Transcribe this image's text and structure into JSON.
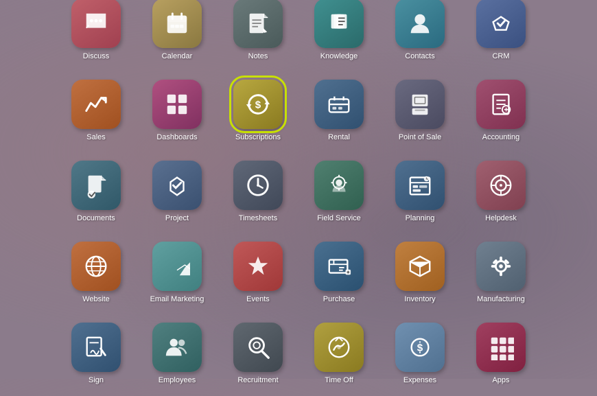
{
  "apps": [
    {
      "id": "discuss",
      "label": "Discuss",
      "bg": "bg-discuss",
      "icon": "discuss"
    },
    {
      "id": "calendar",
      "label": "Calendar",
      "bg": "bg-calendar",
      "icon": "calendar"
    },
    {
      "id": "notes",
      "label": "Notes",
      "bg": "bg-notes",
      "icon": "notes"
    },
    {
      "id": "knowledge",
      "label": "Knowledge",
      "bg": "bg-knowledge",
      "icon": "knowledge"
    },
    {
      "id": "contacts",
      "label": "Contacts",
      "bg": "bg-contacts",
      "icon": "contacts"
    },
    {
      "id": "crm",
      "label": "CRM",
      "bg": "bg-crm",
      "icon": "crm"
    },
    {
      "id": "sales",
      "label": "Sales",
      "bg": "bg-sales",
      "icon": "sales"
    },
    {
      "id": "dashboards",
      "label": "Dashboards",
      "bg": "bg-dashboards",
      "icon": "dashboards"
    },
    {
      "id": "subscriptions",
      "label": "Subscriptions",
      "bg": "bg-subscriptions",
      "icon": "subscriptions",
      "highlight": true
    },
    {
      "id": "rental",
      "label": "Rental",
      "bg": "bg-rental",
      "icon": "rental"
    },
    {
      "id": "pos",
      "label": "Point of Sale",
      "bg": "bg-pos",
      "icon": "pos"
    },
    {
      "id": "accounting",
      "label": "Accounting",
      "bg": "bg-accounting",
      "icon": "accounting"
    },
    {
      "id": "documents",
      "label": "Documents",
      "bg": "bg-documents",
      "icon": "documents"
    },
    {
      "id": "project",
      "label": "Project",
      "bg": "bg-project",
      "icon": "project"
    },
    {
      "id": "timesheets",
      "label": "Timesheets",
      "bg": "bg-timesheets",
      "icon": "timesheets"
    },
    {
      "id": "fieldservice",
      "label": "Field Service",
      "bg": "bg-fieldservice",
      "icon": "fieldservice"
    },
    {
      "id": "planning",
      "label": "Planning",
      "bg": "bg-planning",
      "icon": "planning"
    },
    {
      "id": "helpdesk",
      "label": "Helpdesk",
      "bg": "bg-helpdesk",
      "icon": "helpdesk"
    },
    {
      "id": "website",
      "label": "Website",
      "bg": "bg-website",
      "icon": "website"
    },
    {
      "id": "emailmkt",
      "label": "Email Marketing",
      "bg": "bg-emailmkt",
      "icon": "emailmkt"
    },
    {
      "id": "events",
      "label": "Events",
      "bg": "bg-events",
      "icon": "events"
    },
    {
      "id": "purchase",
      "label": "Purchase",
      "bg": "bg-purchase",
      "icon": "purchase"
    },
    {
      "id": "inventory",
      "label": "Inventory",
      "bg": "bg-inventory",
      "icon": "inventory"
    },
    {
      "id": "manufacturing",
      "label": "Manufacturing",
      "bg": "bg-manufacturing",
      "icon": "manufacturing"
    },
    {
      "id": "sign",
      "label": "Sign",
      "bg": "bg-sign",
      "icon": "sign"
    },
    {
      "id": "employees",
      "label": "Employees",
      "bg": "bg-employees",
      "icon": "employees"
    },
    {
      "id": "recruitment",
      "label": "Recruitment",
      "bg": "bg-recruitment",
      "icon": "recruitment"
    },
    {
      "id": "timeoff",
      "label": "Time Off",
      "bg": "bg-timeoff",
      "icon": "timeoff"
    },
    {
      "id": "expenses",
      "label": "Expenses",
      "bg": "bg-expenses",
      "icon": "expenses"
    },
    {
      "id": "apps",
      "label": "Apps",
      "bg": "bg-apps",
      "icon": "apps"
    }
  ]
}
